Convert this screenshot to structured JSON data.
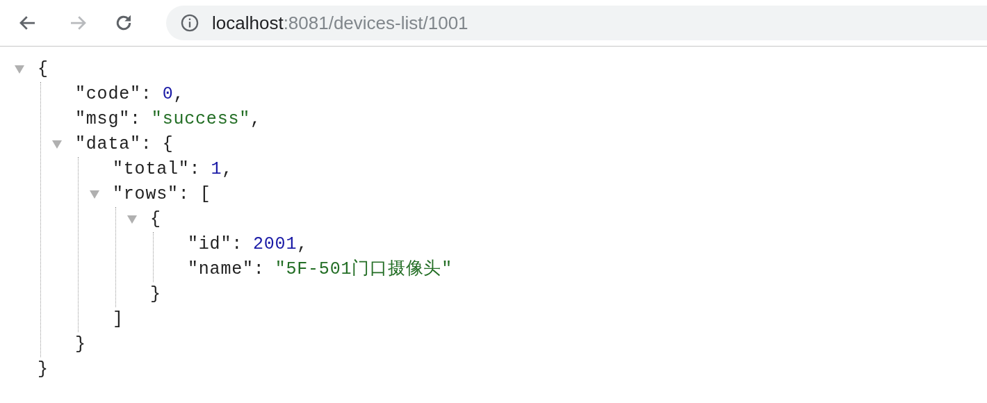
{
  "toolbar": {
    "back": {
      "disabled": false
    },
    "forward": {
      "disabled": true
    },
    "address": {
      "host": "localhost",
      "path": ":8081/devices-list/1001"
    }
  },
  "viewer": {
    "root": {
      "open": "{",
      "expanded": true,
      "close": "}",
      "children": [
        {
          "key": "\"code\":",
          "value": "0",
          "kind": "number",
          "trail": ","
        },
        {
          "key": "\"msg\":",
          "value": "\"success\"",
          "kind": "string",
          "trail": ","
        },
        {
          "key": "\"data\":",
          "open": "{",
          "expanded": true,
          "close": "}",
          "children": [
            {
              "key": "\"total\":",
              "value": "1",
              "kind": "number",
              "trail": ","
            },
            {
              "key": "\"rows\":",
              "open": "[",
              "expanded": true,
              "close": "]",
              "children": [
                {
                  "open": "{",
                  "expanded": true,
                  "close": "}",
                  "children": [
                    {
                      "key": "\"id\":",
                      "value": "2001",
                      "kind": "number",
                      "trail": ","
                    },
                    {
                      "key": "\"name\":",
                      "value": "\"5F-501门口摄像头\"",
                      "kind": "string"
                    }
                  ]
                }
              ]
            }
          ]
        }
      ]
    }
  }
}
